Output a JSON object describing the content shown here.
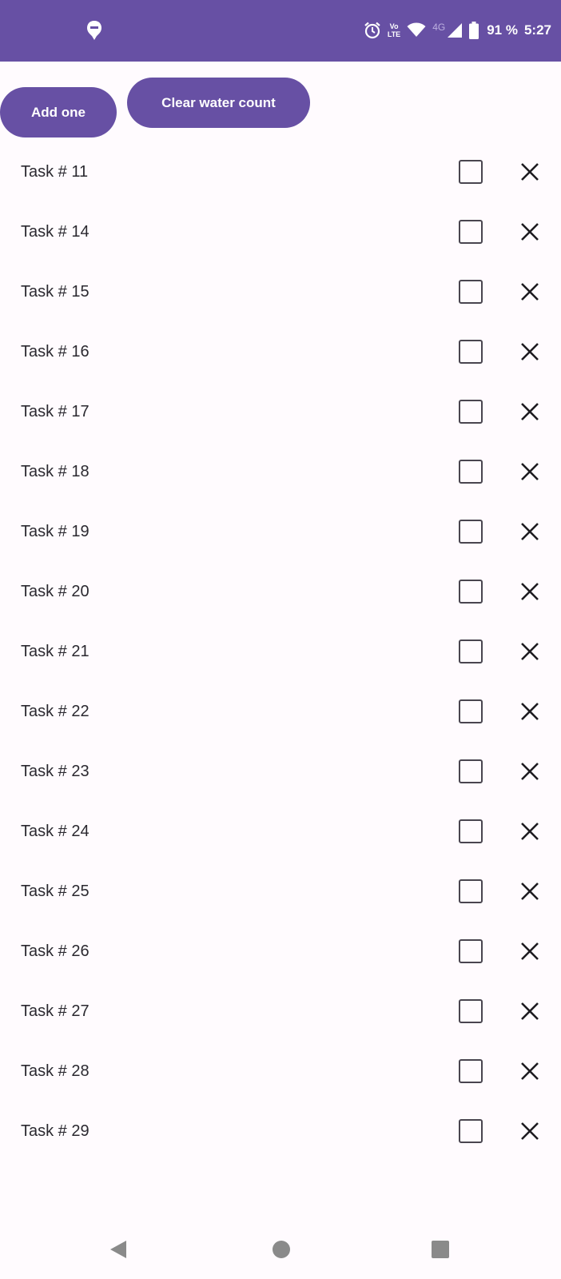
{
  "status_bar": {
    "volte_top": "Vo",
    "volte_bottom": "LTE",
    "network_type": "4G",
    "battery": "91 %",
    "time": "5:27",
    "icons": [
      "app-notification-icon",
      "alarm-icon",
      "volte-icon",
      "wifi-icon",
      "signal-icon",
      "battery-icon"
    ],
    "color": "#6750a4"
  },
  "actions": {
    "add_label": "Add one",
    "clear_label": "Clear water count"
  },
  "tasks": [
    {
      "label": "Task # 11",
      "checked": false
    },
    {
      "label": "Task # 14",
      "checked": false
    },
    {
      "label": "Task # 15",
      "checked": false
    },
    {
      "label": "Task # 16",
      "checked": false
    },
    {
      "label": "Task # 17",
      "checked": false
    },
    {
      "label": "Task # 18",
      "checked": false
    },
    {
      "label": "Task # 19",
      "checked": false
    },
    {
      "label": "Task # 20",
      "checked": false
    },
    {
      "label": "Task # 21",
      "checked": false
    },
    {
      "label": "Task # 22",
      "checked": false
    },
    {
      "label": "Task # 23",
      "checked": false
    },
    {
      "label": "Task # 24",
      "checked": false
    },
    {
      "label": "Task # 25",
      "checked": false
    },
    {
      "label": "Task # 26",
      "checked": false
    },
    {
      "label": "Task # 27",
      "checked": false
    },
    {
      "label": "Task # 28",
      "checked": false
    },
    {
      "label": "Task # 29",
      "checked": false
    }
  ],
  "nav_bar": {
    "icons": [
      "back-icon",
      "home-icon",
      "recents-icon"
    ]
  }
}
